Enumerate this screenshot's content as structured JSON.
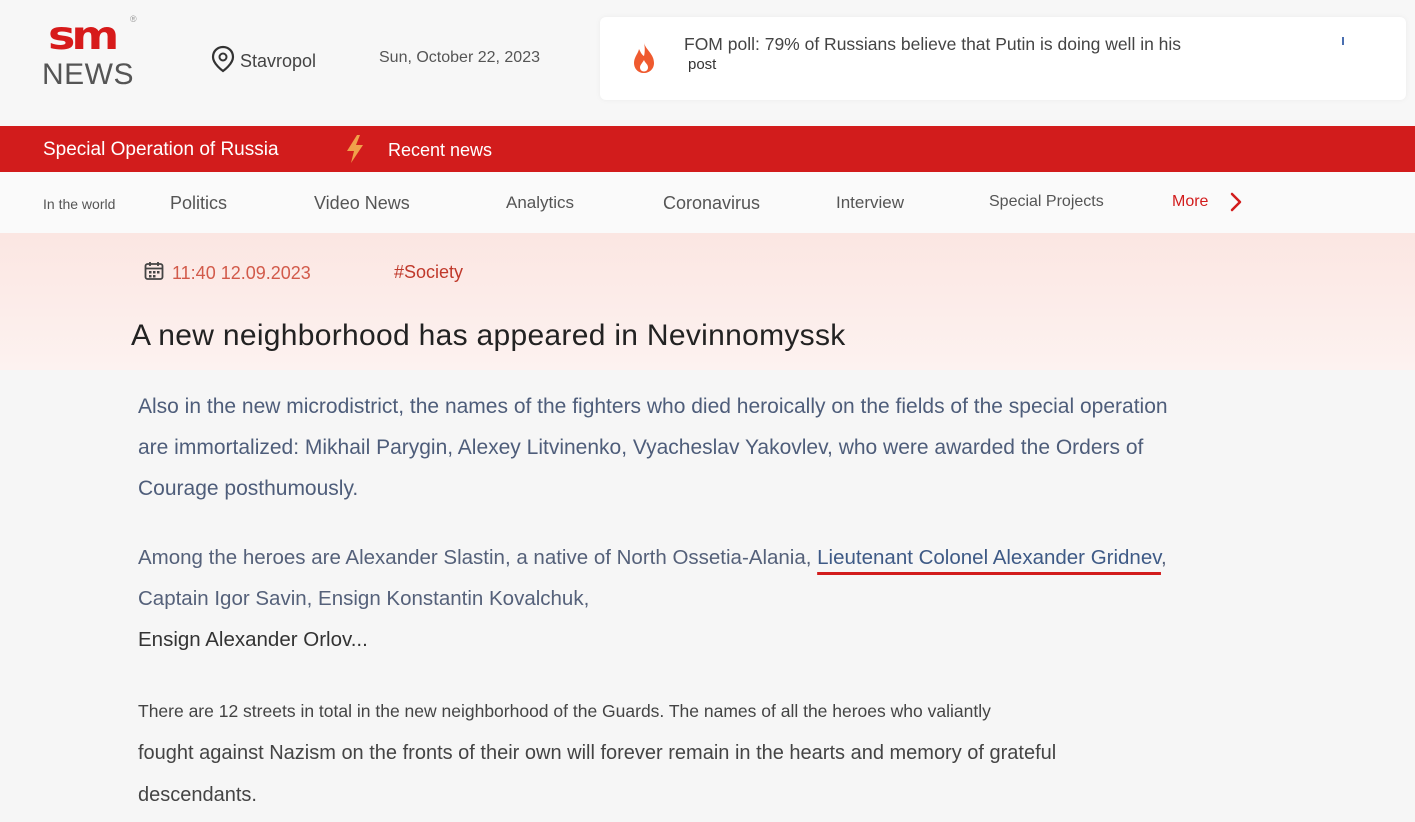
{
  "header": {
    "logo_sm": "sm",
    "logo_reg": "®",
    "logo_news": "NEWS",
    "location": "Stavropol",
    "date": "Sun, October 22, 2023",
    "ticker_text": "FOM poll: 79% of Russians believe that Putin is doing well in his",
    "ticker_more": "post"
  },
  "redbar": {
    "special_operation": "Special Operation of Russia",
    "recent_news": "Recent news"
  },
  "nav": {
    "items": [
      "In the world",
      "Politics",
      "Video News",
      "Analytics",
      "Coronavirus",
      "Interview",
      "Special Projects"
    ],
    "more": "More"
  },
  "article": {
    "time": "11:40 12.09.2023",
    "tag": "#Society",
    "title": "A new neighborhood has appeared in Nevinnomyssk",
    "p1": "Also in the new microdistrict, the names of the fighters who died heroically on the fields of the special operation are immortalized: Mikhail Parygin, Alexey Litvinenko, Vyacheslav Yakovlev, who were awarded the Orders of Courage posthumously.",
    "p2_start": "Among the heroes are Alexander Slastin, a native of North Ossetia-Alania, ",
    "p2_link": "Lieutenant Colonel Alexander Gridnev",
    "p2_mid": ", Captain Igor Savin, Ensign Konstantin Kovalchuk,",
    "p2_end": "Ensign Alexander Orlov...",
    "p3_start": "There are 12 streets in total in the new neighborhood of the Guards. The names of all the heroes who valiantly",
    "p3_end": "fought against Nazism on the fronts of their own will forever remain in the hearts and memory of grateful descendants."
  },
  "colors": {
    "brand_red": "#d21c1c",
    "hero_bg": "#fbe6e2"
  }
}
